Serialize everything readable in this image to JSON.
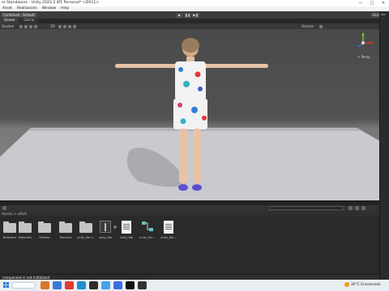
{
  "window": {
    "title": "ro Standalone - Unity 2023.2.4f1 Personal* <DX11>",
    "buttons": [
      "—",
      "□",
      "✕"
    ]
  },
  "menu": [
    "Asset",
    "Realización",
    "Window",
    "Help"
  ],
  "toolbar": {
    "left_buttons": [
      "Combined",
      "Default"
    ],
    "play_buttons": [
      "▶",
      "❚❚",
      "▶❚"
    ],
    "right_label": "Account"
  },
  "tabs": [
    {
      "label": "Scene",
      "active": true
    },
    {
      "label": "Game",
      "active": false
    }
  ],
  "scene_toolbar": {
    "view_mode": "Shaded",
    "render_mode": "2D",
    "gizmos": "Gizmos"
  },
  "gizmo": {
    "projection_label": "< Persp"
  },
  "right_dock": {
    "label": "Acc"
  },
  "project": {
    "breadcrumb": "Assets > xRUS",
    "assets": [
      {
        "name": "Bidiment",
        "icon": "folder-icon"
      },
      {
        "name": "Materials",
        "icon": "folder-icon"
      },
      {
        "name": "Prefabs",
        "icon": "folder-icon"
      },
      {
        "name": "Textures",
        "icon": "folder-icon"
      },
      {
        "name": "unity_file f...",
        "icon": "folder-icon"
      },
      {
        "name": "unity_file",
        "icon": "prefab-icon"
      },
      {
        "name": "unity_file",
        "icon": "document-icon"
      },
      {
        "name": "unity_file...",
        "icon": "graph-icon"
      },
      {
        "name": "unity_file...",
        "icon": "document-icon"
      }
    ]
  },
  "status": {
    "message": "component is not initialized"
  },
  "taskbar": {
    "weather": "30°C  Ensolarado"
  },
  "colors": {
    "viewport_sky": "#4a4a4a",
    "viewport_floor": "#8d8d8d",
    "dress_base": "#f2f2f2"
  }
}
